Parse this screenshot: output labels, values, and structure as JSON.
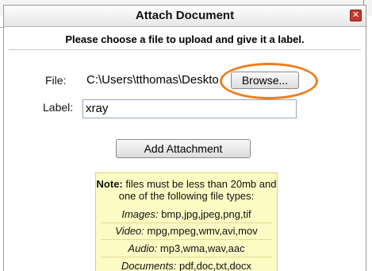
{
  "dialog": {
    "title": "Attach Document",
    "close_symbol": "✕",
    "instructions": "Please choose a file to upload and give it a label.",
    "file_label": "File:",
    "file_path": "C:\\Users\\tthomas\\Desk",
    "file_path_cursor": "to",
    "browse_label": "Browse...",
    "label_label": "Label:",
    "label_value": "xray",
    "add_button_label": "Add Attachment"
  },
  "note": {
    "prefix": "Note:",
    "text": "files must be less than 20mb and one of the following file types:",
    "types": [
      {
        "name": "Images:",
        "extensions": "bmp,jpg,jpeg,png,tif"
      },
      {
        "name": "Video:",
        "extensions": "mpg,mpeg,wmv,avi,mov"
      },
      {
        "name": "Audio:",
        "extensions": "mp3,wma,wav,aac"
      },
      {
        "name": "Documents:",
        "extensions": "pdf,doc,txt,docx"
      }
    ]
  },
  "colors": {
    "highlight": "#ef7d1b",
    "close_button": "#c0392b",
    "note_background": "#fdfbc4"
  },
  "icons": {
    "close": "close-icon"
  }
}
